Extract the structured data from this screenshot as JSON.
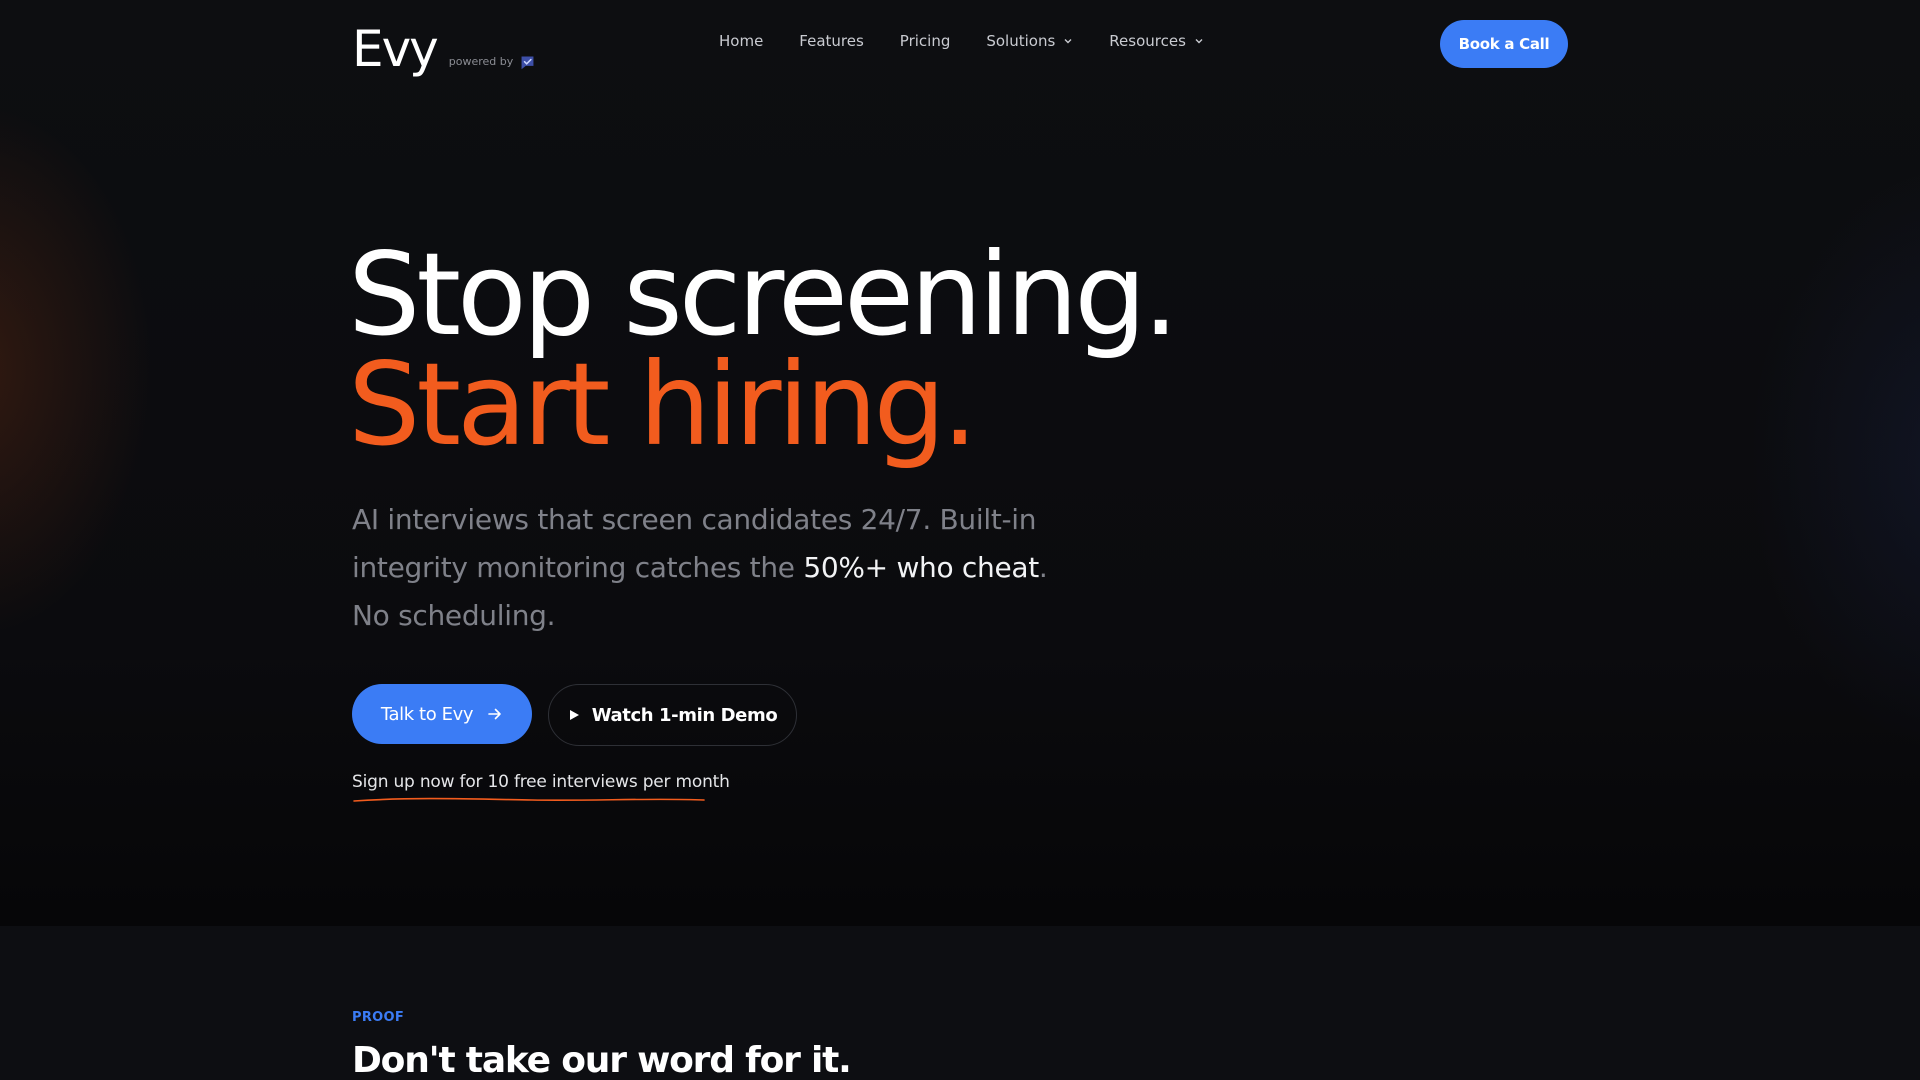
{
  "brand": {
    "logo_text": "Evy",
    "powered_by": "powered by",
    "powered_icon": "checkmark-chat-icon"
  },
  "nav": {
    "items": [
      {
        "label": "Home",
        "has_dropdown": false
      },
      {
        "label": "Features",
        "has_dropdown": false
      },
      {
        "label": "Pricing",
        "has_dropdown": false
      },
      {
        "label": "Solutions",
        "has_dropdown": true
      },
      {
        "label": "Resources",
        "has_dropdown": true
      }
    ],
    "cta_label": "Book a Call"
  },
  "hero": {
    "headline_line1": "Stop screening.",
    "headline_line2": "Start hiring.",
    "subtext_part1": "AI interviews that screen candidates 24/7. Built-in integrity monitoring catches the ",
    "subtext_highlight": "50%+ who cheat",
    "subtext_part2": ". No scheduling.",
    "primary_cta": "Talk to Evy",
    "secondary_cta": "Watch 1-min Demo",
    "signup_text": "Sign up now for 10 free interviews per month"
  },
  "proof": {
    "label": "PROOF",
    "title": "Don't take our word for it."
  },
  "colors": {
    "accent_blue": "#3b7cf5",
    "accent_orange": "#f25c1e",
    "background": "#0b0b0e"
  }
}
